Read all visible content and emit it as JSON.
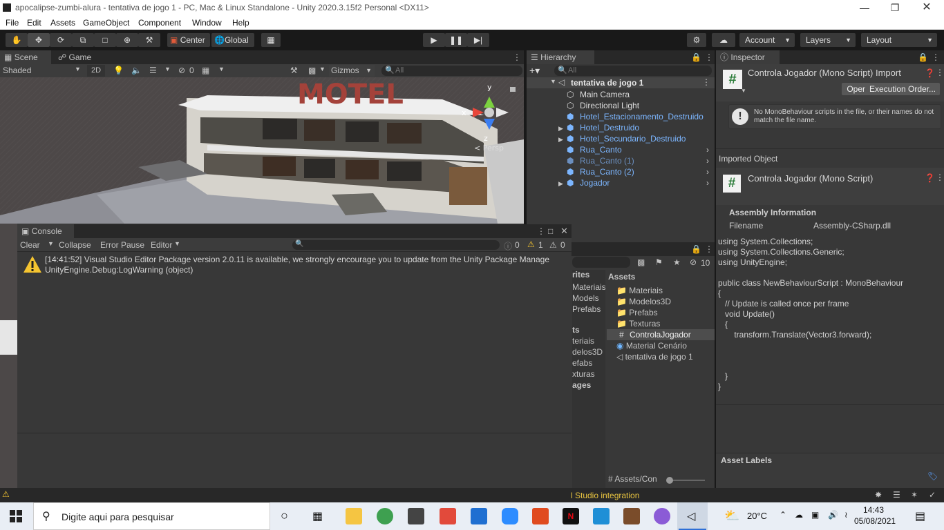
{
  "window": {
    "title": "apocalipse-zumbi-alura - tentativa de jogo 1 - PC, Mac & Linux Standalone - Unity 2020.3.15f2 Personal <DX11>"
  },
  "menu": [
    "File",
    "Edit",
    "Assets",
    "GameObject",
    "Component",
    "Window",
    "Help"
  ],
  "toolbar": {
    "pivot_label": "Center",
    "space_label": "Global",
    "account_label": "Account",
    "layers_label": "Layers",
    "layout_label": "Layout"
  },
  "scene": {
    "tab_scene": "Scene",
    "tab_game": "Game",
    "shading_mode": "Shaded",
    "mode_2d": "2D",
    "hidden_count": "0",
    "gizmos_label": "Gizmos",
    "search_placeholder": "All",
    "persp_label": "< Persp",
    "axis_y": "y",
    "axis_x": "x",
    "axis_z": "z",
    "sign_text": "MOTEL"
  },
  "hierarchy": {
    "tab_label": "Hierarchy",
    "search_placeholder": "All",
    "scene_name": "tentativa de jogo 1",
    "items": [
      {
        "name": "Main Camera"
      },
      {
        "name": "Directional Light"
      },
      {
        "name": "Hotel_Estacionamento_Destruido"
      },
      {
        "name": "Hotel_Destruido"
      },
      {
        "name": "Hotel_Secundario_Destruido"
      },
      {
        "name": "Rua_Canto"
      },
      {
        "name": "Rua_Canto (1)"
      },
      {
        "name": "Rua_Canto (2)"
      },
      {
        "name": "Jogador"
      }
    ]
  },
  "console": {
    "tab_label": "Console",
    "clear_label": "Clear",
    "collapse_label": "Collapse",
    "error_pause_label": "Error Pause",
    "editor_label": "Editor",
    "info_count": "0",
    "warning_count": "1",
    "error_count": "0",
    "entries": [
      {
        "line1": "[14:41:52] Visual Studio Editor Package version 2.0.11 is available, we strongly encourage you to update from the Unity Package Manage",
        "line2": "UnityEngine.Debug:LogWarning (object)"
      }
    ]
  },
  "project": {
    "hidden_count": "10",
    "sidebar_items": [
      "rites",
      "Materiais",
      "Models",
      "Prefabs",
      "ts",
      "teriais",
      "delos3D",
      "efabs",
      "xturas",
      "ages"
    ],
    "breadcrumb": "Assets",
    "assets": [
      {
        "name": "Materiais",
        "type": "folder"
      },
      {
        "name": "Modelos3D",
        "type": "folder"
      },
      {
        "name": "Prefabs",
        "type": "folder"
      },
      {
        "name": "Texturas",
        "type": "folder"
      },
      {
        "name": "ControlaJogador",
        "type": "script"
      },
      {
        "name": "Material Cenário",
        "type": "material"
      },
      {
        "name": "tentativa de jogo 1",
        "type": "scene"
      }
    ],
    "footer_path": "Assets/Con"
  },
  "inspector": {
    "tab_label": "Inspector",
    "header_title": "Controla Jogador (Mono Script) Import",
    "open_label": "Open",
    "execution_order_label": "Execution Order...",
    "warning_text": "No MonoBehaviour scripts in the file, or their names do not match the file name.",
    "imported_object_label": "Imported Object",
    "script_title": "Controla Jogador (Mono Script)",
    "assembly_info_label": "Assembly Information",
    "filename_key": "Filename",
    "filename_value": "Assembly-CSharp.dll",
    "code_lines": [
      "using System.Collections;",
      "using System.Collections.Generic;",
      "using UnityEngine;",
      "",
      "public class NewBehaviourScript : MonoBehaviour",
      "{",
      "   // Update is called once per frame",
      "   void Update()",
      "   {",
      "       transform.Translate(Vector3.forward);",
      "",
      "",
      "",
      "   }",
      "}"
    ],
    "asset_labels_label": "Asset Labels"
  },
  "status_bar": {
    "message": "l Studio integration"
  },
  "taskbar": {
    "search_placeholder": "Digite aqui para pesquisar",
    "temperature": "20°C",
    "time": "14:43",
    "date": "05/08/2021"
  },
  "colors": {
    "prefab_blue": "#7cb6ff",
    "panel_bg": "#383838",
    "toolbar_bg": "#191919",
    "warning_yellow": "#f4c430"
  }
}
